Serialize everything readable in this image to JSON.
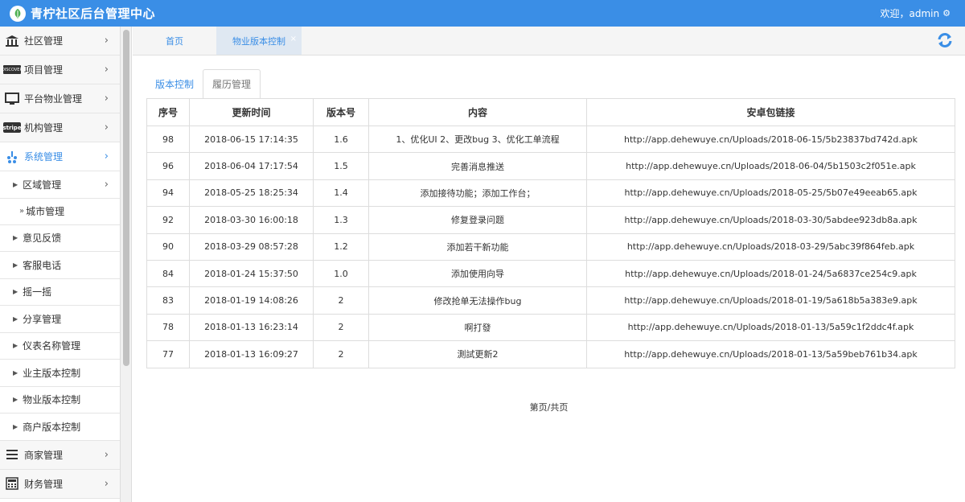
{
  "app": {
    "title": "青柠社区后台管理中心",
    "welcome": "欢迎，admin"
  },
  "sidebar": {
    "top_items": [
      {
        "label": "社区管理",
        "icon": "bank-icon"
      },
      {
        "label": "项目管理",
        "icon": "discover-card-icon",
        "badge": "DISCOVER"
      },
      {
        "label": "平台物业管理",
        "icon": "monitor-icon"
      },
      {
        "label": "机构管理",
        "icon": "stripe-icon",
        "badge": "stripe"
      },
      {
        "label": "系统管理",
        "icon": "yelp-icon",
        "active": true
      }
    ],
    "sub_items": [
      {
        "label": "区域管理",
        "has_chevron": true
      },
      {
        "label": "城市管理",
        "level": 3
      },
      {
        "label": "意见反馈"
      },
      {
        "label": "客服电话"
      },
      {
        "label": "摇一摇"
      },
      {
        "label": "分享管理"
      },
      {
        "label": "仪表名称管理"
      },
      {
        "label": "业主版本控制"
      },
      {
        "label": "物业版本控制"
      },
      {
        "label": "商户版本控制"
      }
    ],
    "bottom_items": [
      {
        "label": "商家管理",
        "icon": "menu-lines-icon"
      },
      {
        "label": "财务管理",
        "icon": "calculator-icon"
      }
    ]
  },
  "tabs": {
    "home": "首页",
    "active": "物业版本控制",
    "close": "×"
  },
  "subtabs": {
    "first": "版本控制",
    "second": "履历管理"
  },
  "table": {
    "headers": [
      "序号",
      "更新时间",
      "版本号",
      "内容",
      "安卓包链接"
    ],
    "rows": [
      [
        "98",
        "2018-06-15 17:14:35",
        "1.6",
        "1、优化UI 2、更改bug 3、优化工单流程",
        "http://app.dehewuye.cn/Uploads/2018-06-15/5b23837bd742d.apk"
      ],
      [
        "96",
        "2018-06-04 17:17:54",
        "1.5",
        "完善消息推送",
        "http://app.dehewuye.cn/Uploads/2018-06-04/5b1503c2f051e.apk"
      ],
      [
        "94",
        "2018-05-25 18:25:34",
        "1.4",
        "添加接待功能；添加工作台；",
        "http://app.dehewuye.cn/Uploads/2018-05-25/5b07e49eeab65.apk"
      ],
      [
        "92",
        "2018-03-30 16:00:18",
        "1.3",
        "修复登录问题",
        "http://app.dehewuye.cn/Uploads/2018-03-30/5abdee923db8a.apk"
      ],
      [
        "90",
        "2018-03-29 08:57:28",
        "1.2",
        "添加若干新功能",
        "http://app.dehewuye.cn/Uploads/2018-03-29/5abc39f864feb.apk"
      ],
      [
        "84",
        "2018-01-24 15:37:50",
        "1.0",
        "添加使用向导",
        "http://app.dehewuye.cn/Uploads/2018-01-24/5a6837ce254c9.apk"
      ],
      [
        "83",
        "2018-01-19 14:08:26",
        "2",
        "修改抢单无法操作bug",
        "http://app.dehewuye.cn/Uploads/2018-01-19/5a618b5a383e9.apk"
      ],
      [
        "78",
        "2018-01-13 16:23:14",
        "2",
        "啊打發",
        "http://app.dehewuye.cn/Uploads/2018-01-13/5a59c1f2ddc4f.apk"
      ],
      [
        "77",
        "2018-01-13 16:09:27",
        "2",
        "測試更新2",
        "http://app.dehewuye.cn/Uploads/2018-01-13/5a59beb761b34.apk"
      ]
    ]
  },
  "pager": {
    "text": "第页/共页"
  },
  "colors": {
    "brand": "#3a8ee6"
  }
}
